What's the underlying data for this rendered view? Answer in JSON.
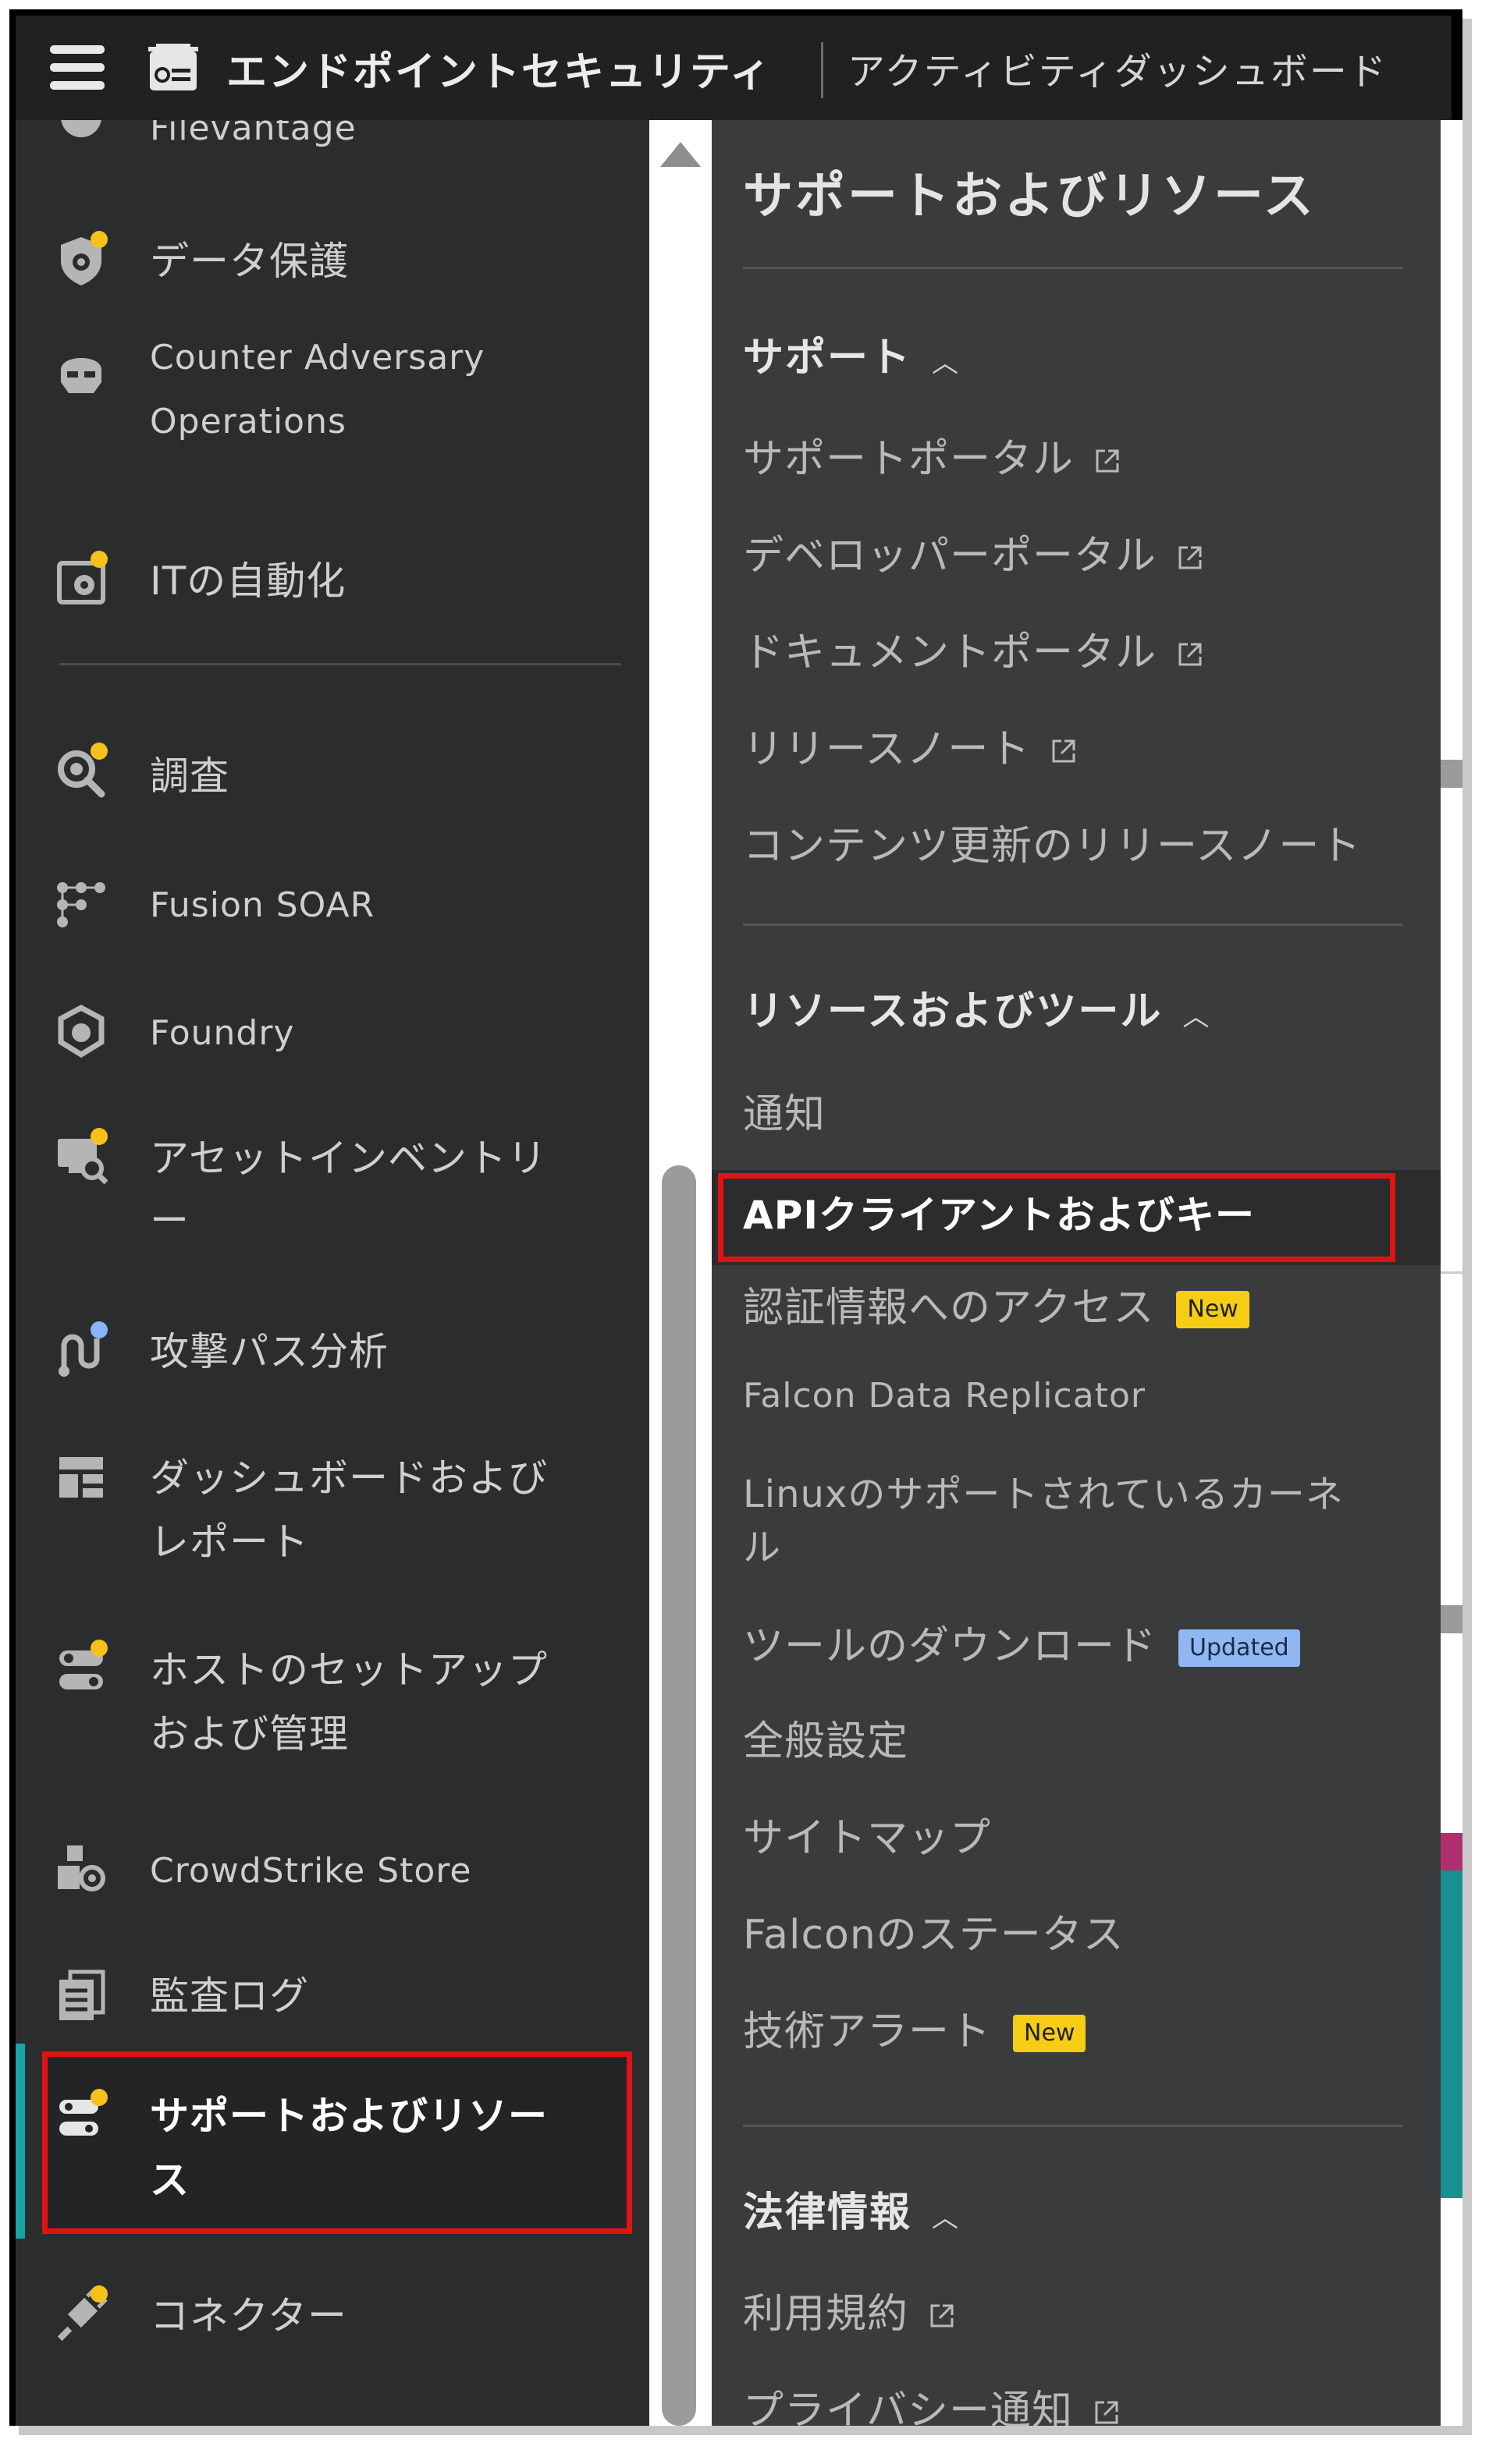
{
  "topbar": {
    "product": "エンドポイントセキュリティ",
    "page_title": "アクティビティダッシュボード"
  },
  "leftnav": {
    "partial_top_label": "Filevantage",
    "items": [
      {
        "label": "データ保護",
        "icon": "data-protection-icon",
        "dot": "yellow"
      },
      {
        "label": "Counter Adversary Operations",
        "label_line1": "Counter Adversary",
        "label_line2": "Operations",
        "icon": "helmet-icon",
        "dot": ""
      },
      {
        "label": "ITの自動化",
        "icon": "it-automation-icon",
        "dot": "yellow"
      },
      {
        "label": "調査",
        "icon": "investigate-icon",
        "dot": "yellow"
      },
      {
        "label": "Fusion SOAR",
        "icon": "fusion-soar-icon",
        "dot": ""
      },
      {
        "label": "Foundry",
        "icon": "foundry-icon",
        "dot": ""
      },
      {
        "label_line1": "アセットインベントリ",
        "label_line2": "ー",
        "icon": "asset-inventory-icon",
        "dot": "yellow"
      },
      {
        "label": "攻撃パス分析",
        "icon": "attack-path-icon",
        "dot": "blue"
      },
      {
        "label_line1": "ダッシュボードおよび",
        "label_line2": "レポート",
        "icon": "dashboard-icon",
        "dot": ""
      },
      {
        "label_line1": "ホストのセットアップ",
        "label_line2": "および管理",
        "icon": "host-setup-icon",
        "dot": "yellow"
      },
      {
        "label": "CrowdStrike Store",
        "icon": "store-icon",
        "dot": ""
      },
      {
        "label": "監査ログ",
        "icon": "audit-log-icon",
        "dot": ""
      },
      {
        "label_line1": "サポートおよびリソー",
        "label_line2": "ス",
        "icon": "support-icon",
        "dot": "yellow",
        "active": true
      },
      {
        "label": "コネクター",
        "icon": "connector-icon",
        "dot": "yellow"
      }
    ]
  },
  "panel": {
    "title": "サポートおよびリソース",
    "support": {
      "heading": "サポート",
      "items": [
        {
          "label": "サポートポータル",
          "external": true
        },
        {
          "label": "デベロッパーポータル",
          "external": true
        },
        {
          "label": "ドキュメントポータル",
          "external": true
        },
        {
          "label": "リリースノート",
          "external": true
        },
        {
          "label": "コンテンツ更新のリリースノート",
          "external": false
        }
      ]
    },
    "resources": {
      "heading": "リソースおよびツール",
      "items": {
        "notifications": "通知",
        "api_clients": "APIクライアントおよびキー",
        "credential_access": "認証情報へのアクセス",
        "falcon_data_replicator": "Falcon Data Replicator",
        "linux_kernels_line1": "Linuxのサポートされているカーネ",
        "linux_kernels_line2": "ル",
        "tool_downloads": "ツールのダウンロード",
        "general_settings": "全般設定",
        "sitemap": "サイトマップ",
        "falcon_status": "Falconのステータス",
        "tech_alerts": "技術アラート"
      },
      "badges": {
        "new": "New",
        "updated": "Updated"
      }
    },
    "legal": {
      "heading": "法律情報",
      "items": [
        {
          "label": "利用規約",
          "external": true
        },
        {
          "label": "プライバシー通知",
          "external": true
        }
      ]
    }
  },
  "colors": {
    "accent_red": "#e01313",
    "badge_new": "#f7cc15",
    "badge_updated": "#8fb8f3",
    "active_bar": "#19a3a6"
  }
}
